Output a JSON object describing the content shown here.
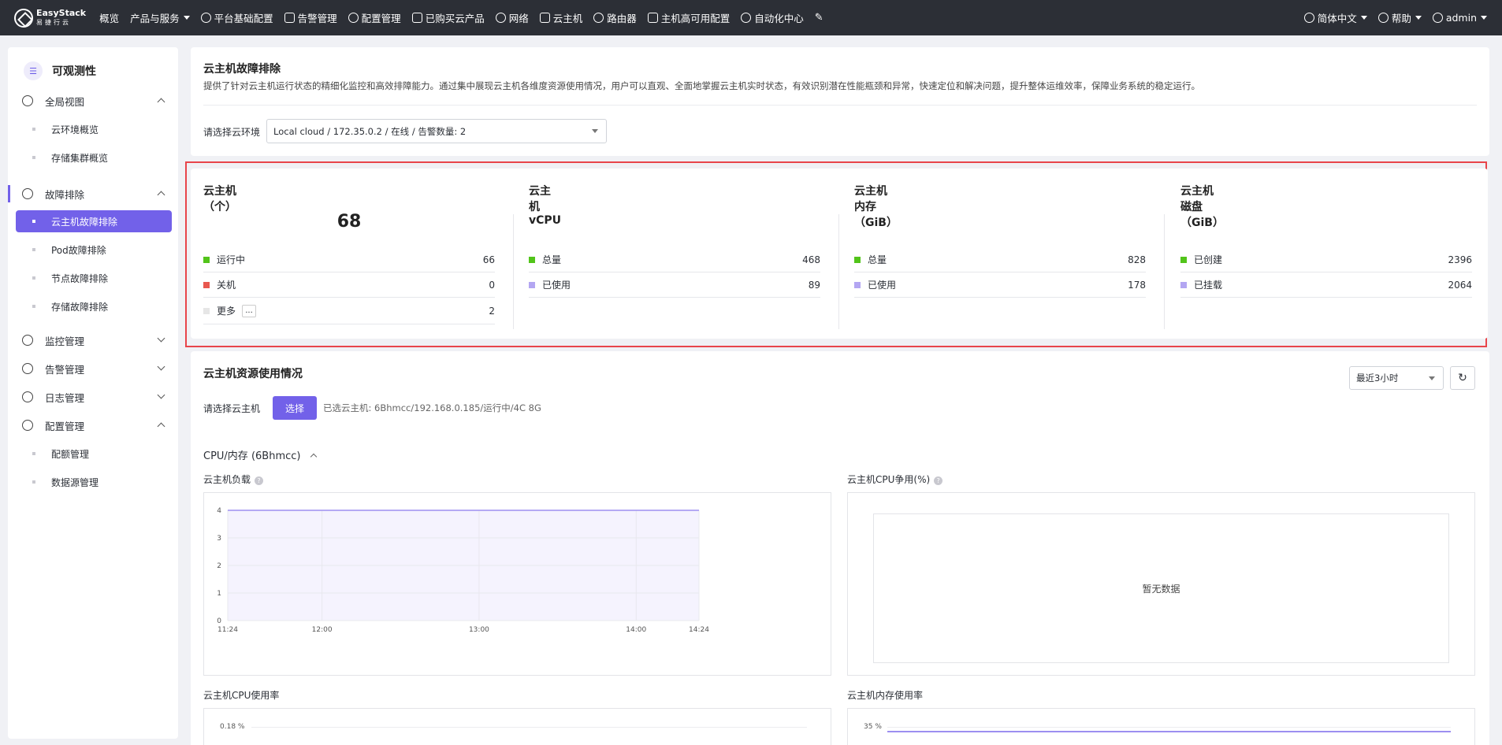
{
  "topbar": {
    "brand_en": "EasyStack",
    "brand_cn": "易捷行云",
    "nav": [
      {
        "label": "概览",
        "icon": "none"
      },
      {
        "label": "产品与服务",
        "icon": "none",
        "dropdown": true
      },
      {
        "label": "平台基础配置",
        "icon": "gear-icon"
      },
      {
        "label": "告警管理",
        "icon": "alarm-icon"
      },
      {
        "label": "配置管理",
        "icon": "gear-icon"
      },
      {
        "label": "已购买云产品",
        "icon": "list-icon"
      },
      {
        "label": "网络",
        "icon": "network-icon"
      },
      {
        "label": "云主机",
        "icon": "cloud-icon"
      },
      {
        "label": "路由器",
        "icon": "router-icon"
      },
      {
        "label": "主机高可用配置",
        "icon": "host-icon"
      },
      {
        "label": "自动化中心",
        "icon": "automation-icon"
      }
    ],
    "right": {
      "language": "简体中文",
      "help": "帮助",
      "user": "admin"
    }
  },
  "sidebar": {
    "title": "可观测性",
    "groups": [
      {
        "label": "全局视图",
        "icon": "globe-icon",
        "expanded": true,
        "items": [
          "云环境概览",
          "存储集群概览"
        ]
      },
      {
        "label": "故障排除",
        "icon": "search-icon",
        "expanded": true,
        "items": [
          "云主机故障排除",
          "Pod故障排除",
          "节点故障排除",
          "存储故障排除"
        ],
        "active": "云主机故障排除"
      },
      {
        "label": "监控管理",
        "icon": "monitor-icon",
        "expanded": false
      },
      {
        "label": "告警管理",
        "icon": "alarm-icon",
        "expanded": false
      },
      {
        "label": "日志管理",
        "icon": "log-icon",
        "expanded": false
      },
      {
        "label": "配置管理",
        "icon": "gear-icon",
        "expanded": true,
        "items": [
          "配额管理",
          "数据源管理"
        ]
      }
    ]
  },
  "header": {
    "title": "云主机故障排除",
    "description": "提供了针对云主机运行状态的精细化监控和高效排障能力。通过集中展现云主机各维度资源使用情况，用户可以直观、全面地掌握云主机实时状态，有效识别潜在性能瓶颈和异常，快速定位和解决问题，提升整体运维效率，保障业务系统的稳定运行。",
    "env_label": "请选择云环境",
    "env_value": "Local cloud / 172.35.0.2 / 在线 / 告警数量: 2"
  },
  "stats": {
    "vm": {
      "title": "云主机（个）",
      "total": "68",
      "rows": [
        {
          "label": "运行中",
          "value": "66",
          "color": "#52c41a"
        },
        {
          "label": "关机",
          "value": "0",
          "color": "#e8584f"
        },
        {
          "label": "更多",
          "value": "2",
          "color": "#e6e6e6",
          "more": "..."
        }
      ]
    },
    "vcpu": {
      "title": "云主机 vCPU",
      "rows": [
        {
          "label": "总量",
          "value": "468",
          "color": "#52c41a"
        },
        {
          "label": "已使用",
          "value": "89",
          "color": "#b3a6f2"
        }
      ]
    },
    "mem": {
      "title": "云主机内存（GiB）",
      "rows": [
        {
          "label": "总量",
          "value": "828",
          "color": "#52c41a"
        },
        {
          "label": "已使用",
          "value": "178",
          "color": "#b3a6f2"
        }
      ]
    },
    "disk": {
      "title": "云主机磁盘（GiB）",
      "rows": [
        {
          "label": "已创建",
          "value": "2396",
          "color": "#52c41a"
        },
        {
          "label": "已挂载",
          "value": "2064",
          "color": "#b3a6f2"
        }
      ]
    }
  },
  "usage": {
    "title": "云主机资源使用情况",
    "time_range": "最近3小时",
    "select_label": "请选择云主机",
    "select_button": "选择",
    "selected_text": "已选云主机:  6Bhmcc/192.168.0.185/运行中/4C 8G",
    "section_title": "CPU/内存 (6Bhmcc)",
    "charts": {
      "load": {
        "title": "云主机负载",
        "help": "?"
      },
      "cpu_steal": {
        "title": "云主机CPU争用(%)",
        "help": "?",
        "empty_text": "暂无数据"
      },
      "cpu_usage": {
        "title": "云主机CPU使用率",
        "top_tick": "0.18 %"
      },
      "mem_usage": {
        "title": "云主机内存使用率",
        "top_tick": "35 %"
      }
    }
  },
  "chart_data": {
    "type": "area",
    "title": "云主机负载",
    "x": [
      "11:24",
      "12:00",
      "13:00",
      "14:00",
      "14:24"
    ],
    "y_ticks": [
      "0",
      "1",
      "2",
      "3",
      "4"
    ],
    "ylim": [
      0,
      4
    ],
    "series": [
      {
        "values": [
          4,
          4,
          4,
          4,
          4
        ]
      }
    ],
    "grid": true,
    "color": "#9d8ff0"
  },
  "colors": {
    "accent": "#7261e9",
    "highlight_border": "#e8454b",
    "topbar": "#2c2f36"
  }
}
